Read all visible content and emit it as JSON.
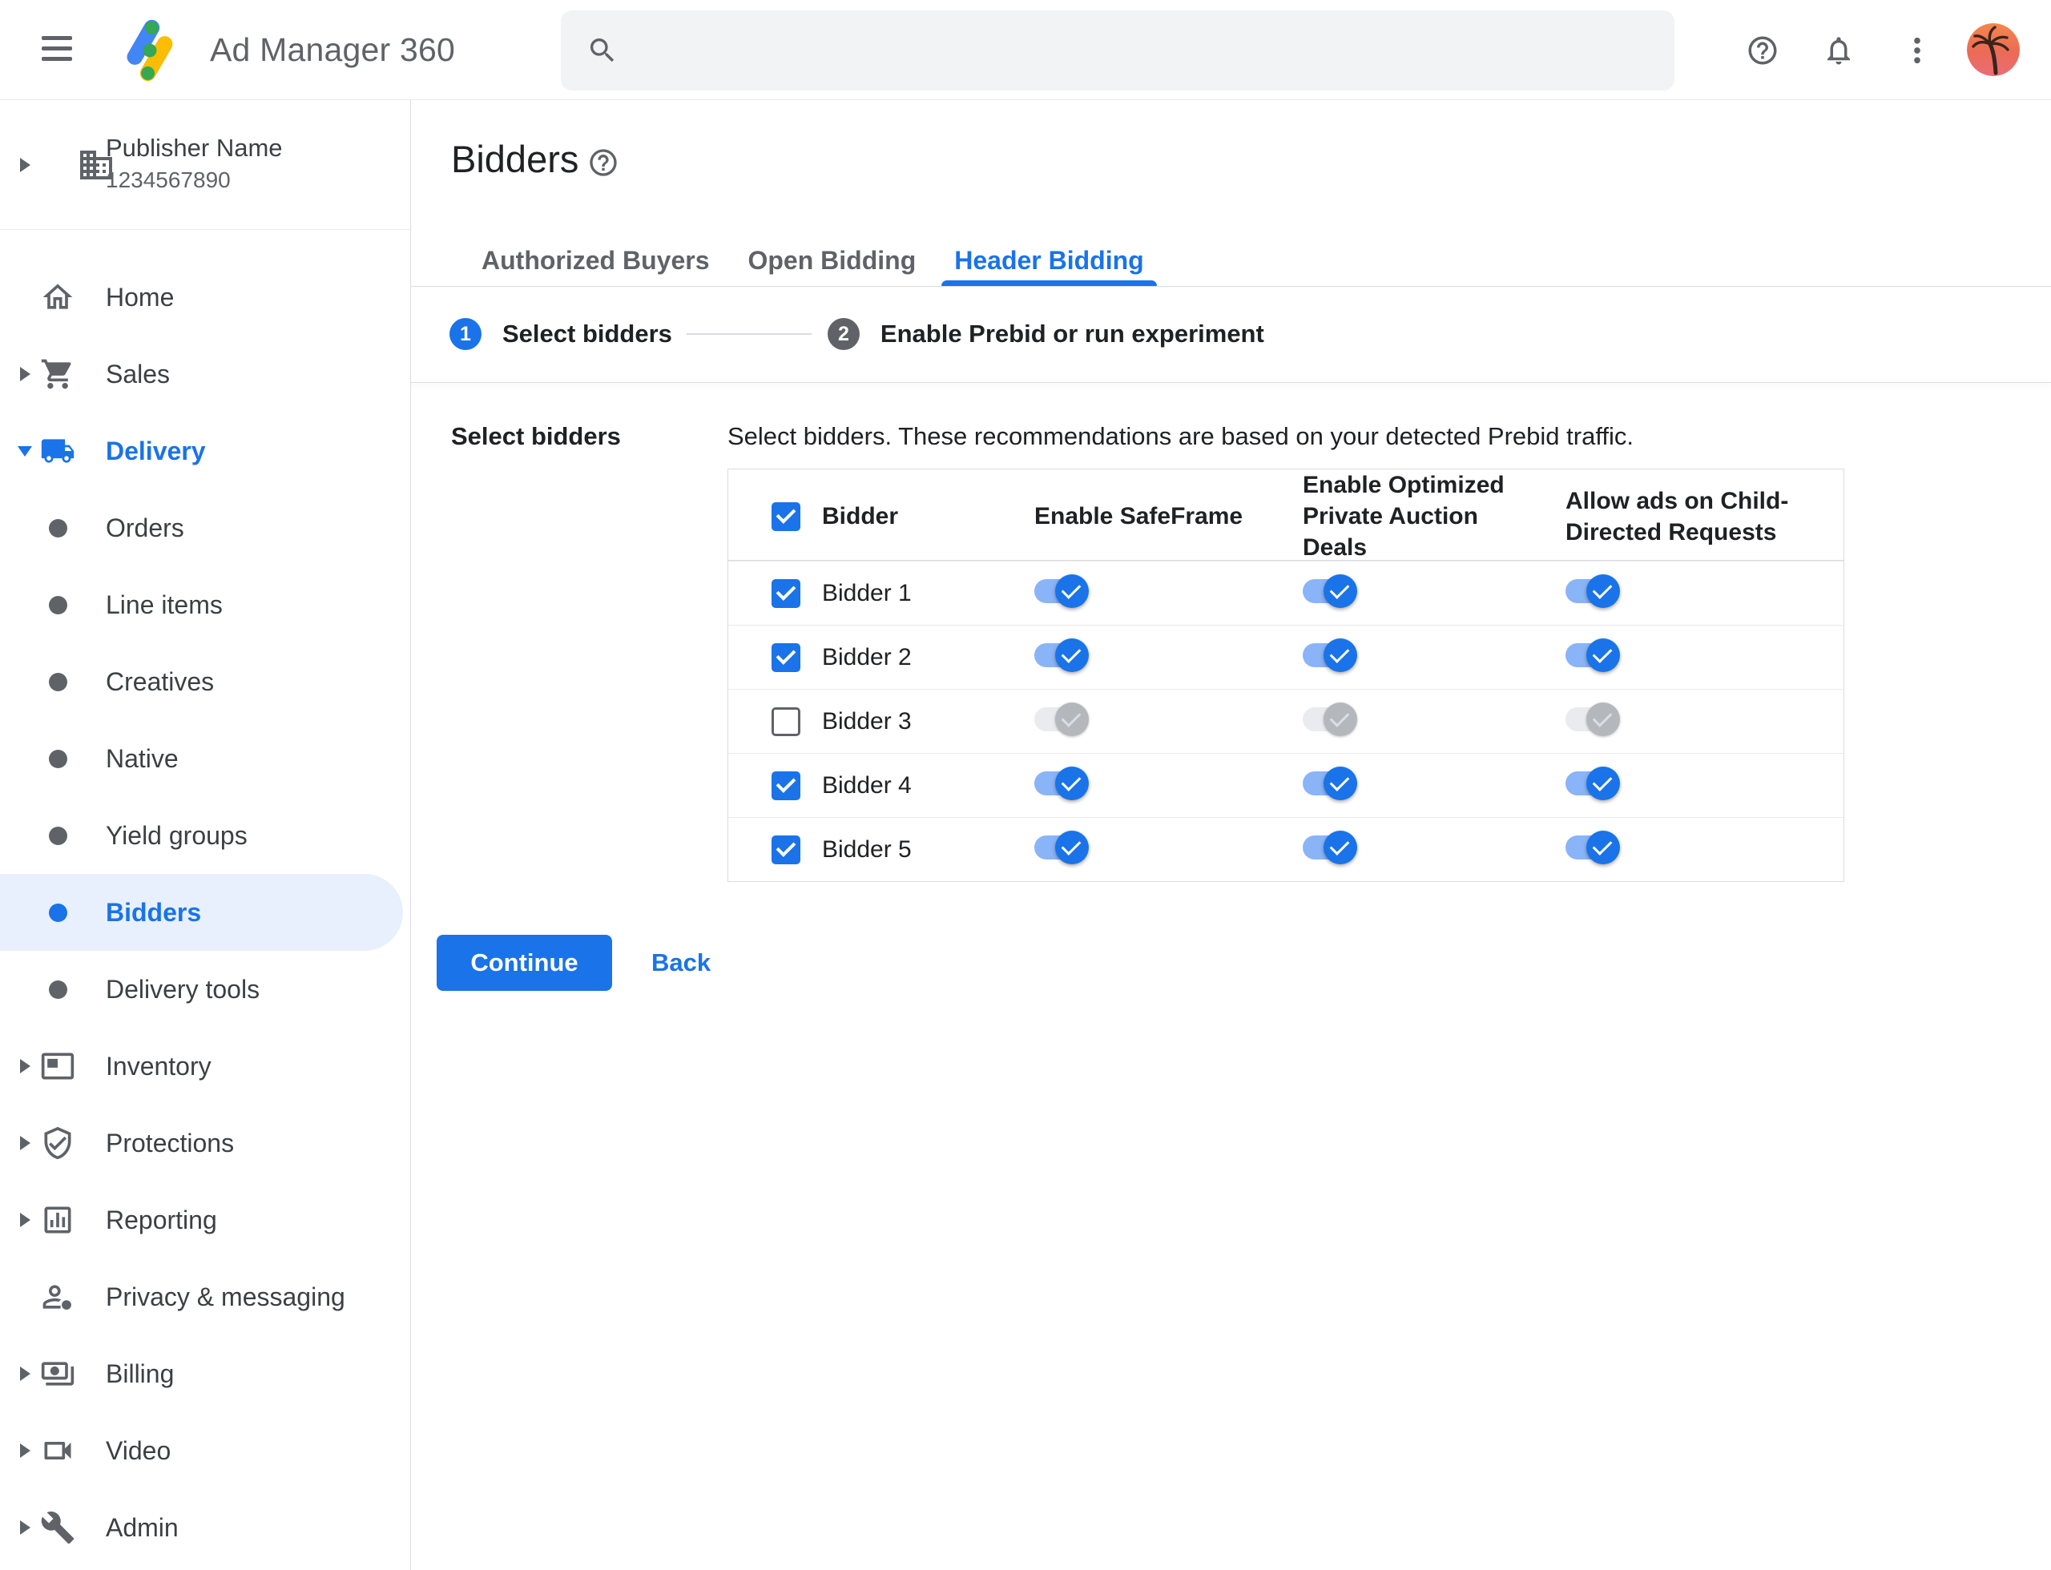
{
  "header": {
    "app_title": "Ad Manager 360",
    "search": {
      "value": "",
      "placeholder": ""
    }
  },
  "sidebar": {
    "publisher": {
      "name": "Publisher Name",
      "id": "1234567890"
    },
    "items": [
      {
        "label": "Home"
      },
      {
        "label": "Sales"
      },
      {
        "label": "Delivery"
      },
      {
        "label": "Orders"
      },
      {
        "label": "Line items"
      },
      {
        "label": "Creatives"
      },
      {
        "label": "Native"
      },
      {
        "label": "Yield groups"
      },
      {
        "label": "Bidders"
      },
      {
        "label": "Delivery tools"
      },
      {
        "label": "Inventory"
      },
      {
        "label": "Protections"
      },
      {
        "label": "Reporting"
      },
      {
        "label": "Privacy & messaging"
      },
      {
        "label": "Billing"
      },
      {
        "label": "Video"
      },
      {
        "label": "Admin"
      }
    ],
    "selected_item": "Bidders",
    "expanded_section": "Delivery"
  },
  "main": {
    "page_title": "Bidders",
    "tabs": [
      {
        "label": "Authorized Buyers"
      },
      {
        "label": "Open Bidding"
      },
      {
        "label": "Header Bidding"
      }
    ],
    "active_tab": "Header Bidding",
    "stepper": {
      "step1_number": "1",
      "step1_label": "Select bidders",
      "step2_number": "2",
      "step2_label": "Enable Prebid or run experiment"
    },
    "section_label": "Select bidders",
    "description": "Select bidders. These recommendations are based on your detected Prebid traffic.",
    "table": {
      "select_all_checked": true,
      "columns": [
        "Bidder",
        "Enable SafeFrame",
        "Enable Optimized Private Auction Deals",
        "Allow ads on Child-Directed Requests"
      ],
      "rows": [
        {
          "name": "Bidder 1",
          "selected": true,
          "enable_safeframe": true,
          "enable_optimized_private_auction_deals": true,
          "allow_ads_child_directed": true
        },
        {
          "name": "Bidder 2",
          "selected": true,
          "enable_safeframe": true,
          "enable_optimized_private_auction_deals": true,
          "allow_ads_child_directed": true
        },
        {
          "name": "Bidder 3",
          "selected": false,
          "enable_safeframe": false,
          "enable_optimized_private_auction_deals": false,
          "allow_ads_child_directed": false
        },
        {
          "name": "Bidder 4",
          "selected": true,
          "enable_safeframe": true,
          "enable_optimized_private_auction_deals": true,
          "allow_ads_child_directed": true
        },
        {
          "name": "Bidder 5",
          "selected": true,
          "enable_safeframe": true,
          "enable_optimized_private_auction_deals": true,
          "allow_ads_child_directed": true
        }
      ]
    },
    "actions": {
      "continue_label": "Continue",
      "back_label": "Back"
    }
  },
  "colors": {
    "accent": "#1a73e8",
    "toggle_track_on": "#8ab4f8",
    "selected_pill_bg": "#e8f0fe",
    "text_primary": "#202124",
    "text_secondary": "#5f6368",
    "border": "#dadce0"
  }
}
